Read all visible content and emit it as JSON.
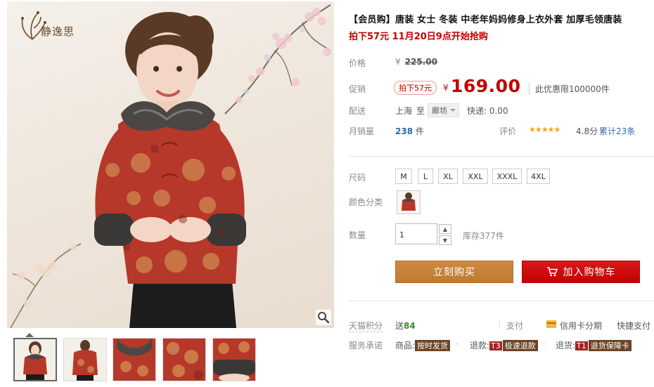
{
  "brand": {
    "name": "静逸思"
  },
  "product": {
    "title": "【会员购】唐装 女士 冬装 中老年妈妈修身上衣外套 加厚毛领唐装",
    "promo_line": "拍下57元 11月20日9点开始抢购"
  },
  "price": {
    "label": "价格",
    "currency": "¥",
    "original": "225.00"
  },
  "promo": {
    "label": "促销",
    "tag": "拍下57元",
    "currency": "¥",
    "price": "169.00",
    "limit": "此优惠限100000件"
  },
  "shipping": {
    "label": "配送",
    "from": "上海",
    "to_word": "至",
    "dest": "廊坊",
    "fee": "快递: 0.00"
  },
  "sales": {
    "label": "月销量",
    "count": "238",
    "unit": "件"
  },
  "rating": {
    "label": "评价",
    "stars": "★★★★★",
    "score": "4.8分",
    "reviews": "累计23条"
  },
  "size": {
    "label": "尺码",
    "options": [
      "M",
      "L",
      "XL",
      "XXL",
      "XXXL",
      "4XL"
    ]
  },
  "color": {
    "label": "颜色分类"
  },
  "quantity": {
    "label": "数量",
    "value": "1",
    "up": "▲",
    "down": "▼",
    "stock": "库存377件"
  },
  "actions": {
    "buy": "立刻购买",
    "cart": "加入购物车"
  },
  "points": {
    "label": "天猫积分",
    "prefix": "送",
    "value": "84"
  },
  "payment": {
    "label": "支付",
    "installment": "信用卡分期",
    "quickpay": "快捷支付"
  },
  "promise": {
    "label": "服务承诺",
    "goods_prefix": "商品:",
    "goods_badge": "按时发货",
    "refund_prefix": "退款:",
    "refund_code": "T3",
    "refund_badge": "极速退款",
    "return_prefix": "退货:",
    "return_code": "T1",
    "return_badge": "退货保障卡",
    "dot": "·"
  },
  "colors": {
    "price_red": "#c40000",
    "buy_brown": "#c8833b",
    "cart_red": "#c40000",
    "link_blue": "#3268a8",
    "star_gold": "#f1a80f"
  }
}
